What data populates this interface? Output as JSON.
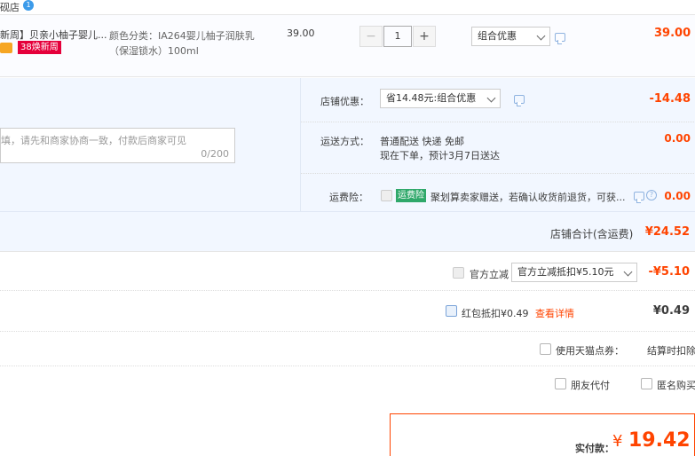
{
  "top": {
    "shop_label": "砚店",
    "badge": "1"
  },
  "item": {
    "title": "新周】贝亲小柚子婴儿...",
    "tag": "38焕新周",
    "sku_label": "颜色分类：IA264婴儿柚子润肤乳",
    "sku_sub": "（保湿锁水）100ml",
    "unit_price": "39.00",
    "quantity": "1",
    "promo_select": "组合优惠",
    "subtotal": "39.00"
  },
  "store": {
    "discount_label": "店铺优惠：",
    "discount_select": "省14.48元:组合优惠",
    "discount_amount": "-14.48",
    "shipping_label": "运送方式：",
    "shipping_line1": "普通配送 快递 免邮",
    "shipping_line2": "现在下单，预计3月7日送达",
    "shipping_amount": "0.00",
    "insurance_label": "运费险：",
    "insurance_tag": "运费险",
    "insurance_text": "聚划算卖家赠送，若确认收货前退货，可获...",
    "insurance_amount": "0.00",
    "message_placeholder": "填，请先和商家协商一致，付款后商家可见",
    "message_counter": "0/200",
    "total_label": "店铺合计(含运费)",
    "total_value": "¥24.52"
  },
  "official": {
    "label": "官方立减",
    "select": "官方立减抵扣¥5.10元",
    "amount": "-¥5.10"
  },
  "redpacket": {
    "label": "红包抵扣¥0.49",
    "link": "查看详情",
    "amount": "¥0.49"
  },
  "tmall_points": {
    "label": "使用天猫点券：",
    "right": "结算时扣除"
  },
  "options": {
    "friend_pay": "朋友代付",
    "anonymous": "匿名购买"
  },
  "payment": {
    "label": "实付款：",
    "currency": "¥",
    "value": "19.42"
  }
}
